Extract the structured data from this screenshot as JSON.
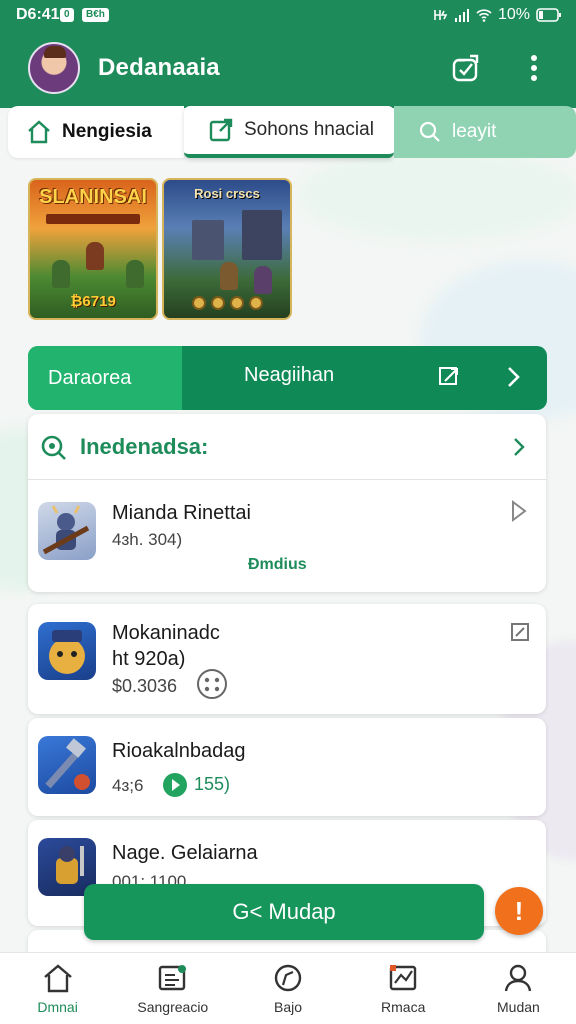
{
  "status_bar": {
    "time": "D6:41",
    "badge1": "0",
    "badge2": "B€h",
    "battery": "10%"
  },
  "header": {
    "title": "Dedanaaia"
  },
  "tabs": [
    {
      "label": "Nengiesia"
    },
    {
      "label": "Sohons hnacial"
    },
    {
      "label": "leayit"
    }
  ],
  "banners": [
    {
      "title": "SLANINSAI",
      "footer": "₿6719"
    },
    {
      "title": "Rosi crscs"
    }
  ],
  "section": {
    "left_label": "Daraorea",
    "mid_label": "Neagiihan"
  },
  "search_card": {
    "title": "Inedenadsa:",
    "item": {
      "name": "Mianda Rinettai",
      "sub": "4ɜh. 304)",
      "badge": "Ɖmdius"
    }
  },
  "items": [
    {
      "name": "Mokaninadc",
      "line2": "ht 920a)",
      "price": "$0.3036"
    },
    {
      "name": "Rioakalnbadag",
      "sub": "4ɜ;6",
      "badge": "155)"
    },
    {
      "name": "Nage. Gelaiarna",
      "sub": "001: 1100"
    }
  ],
  "main_button": {
    "label": "G< Mudap"
  },
  "fab": {
    "label": "!"
  },
  "bottom_nav": [
    {
      "label": "Dmnai"
    },
    {
      "label": "Sangreacio"
    },
    {
      "label": "Bajo"
    },
    {
      "label": "Rmaca"
    },
    {
      "label": "Mudan"
    }
  ],
  "colors": {
    "primary": "#1e8c5a",
    "accent": "#22b36f",
    "fab": "#f0701c"
  }
}
